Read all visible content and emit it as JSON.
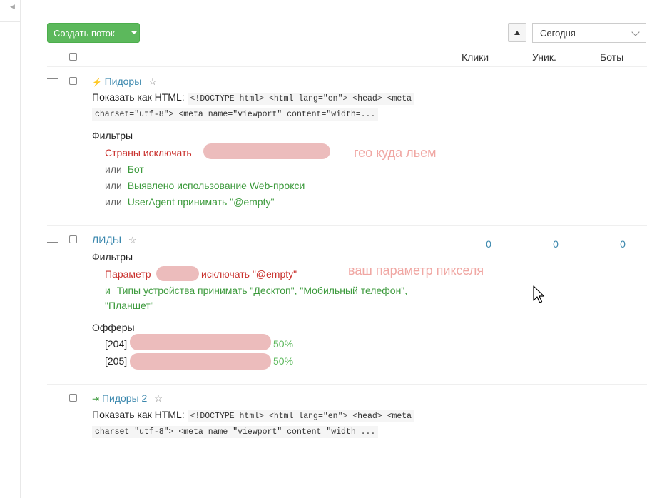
{
  "toolbar": {
    "create_label": "Создать поток",
    "period_value": "Сегодня"
  },
  "columns": {
    "clicks": "Клики",
    "unique": "Уник.",
    "bots": "Боты"
  },
  "flow1": {
    "name": "Пидоры",
    "show_html_label": "Показать как HTML:",
    "code_line1": "<!DOCTYPE html> <html lang=\"en\"> <head> <meta",
    "code_line2": "charset=\"utf-8\"> <meta name=\"viewport\" content=\"width=...",
    "filters_label": "Фильтры",
    "filter1": "Страны исключать",
    "or1": "или",
    "filter2": "Бот",
    "or2": "или",
    "filter3": "Выявлено использование Web-прокси",
    "or3": "или",
    "filter4": "UserAgent принимать \"@empty\"",
    "annotation": "гео куда льем"
  },
  "flow2": {
    "name": "ЛИДЫ",
    "clicks": "0",
    "unique": "0",
    "bots": "0",
    "filters_label": "Фильтры",
    "filter1_a": "Параметр",
    "filter1_b": "исключать \"@empty\"",
    "and1": "и",
    "filter2_line1": "Типы устройства принимать \"Десктоп\", \"Мобильный телефон\",",
    "filter2_line2": "\"Планшет\"",
    "annotation": "ваш параметр пикселя",
    "offers_label": "Офферы",
    "offers": [
      {
        "id": "[204]",
        "share": "50%"
      },
      {
        "id": "[205]",
        "share": "50%"
      }
    ]
  },
  "flow3": {
    "name": "Пидоры 2",
    "show_html_label": "Показать как HTML:",
    "code_line1": "<!DOCTYPE html> <html lang=\"en\"> <head> <meta",
    "code_line2": "charset=\"utf-8\"> <meta name=\"viewport\" content=\"width=..."
  },
  "icons": {
    "flow1_type": "lightning-icon",
    "flow3_type": "redirect-icon",
    "favorite": "star-icon"
  },
  "colors": {
    "primary_button": "#5cb85c",
    "link": "#3a87ad",
    "exclude": "#c9302c",
    "include": "#3c9a3c",
    "annotation": "#f0a7a3"
  }
}
